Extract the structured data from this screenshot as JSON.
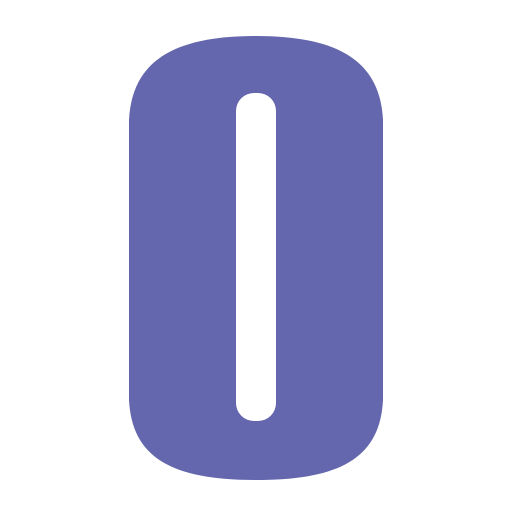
{
  "icon": {
    "name": "zero-digit-icon",
    "fill_color": "#6467ad",
    "background_color": "#ffffff",
    "counter_color": "#ffffff"
  }
}
